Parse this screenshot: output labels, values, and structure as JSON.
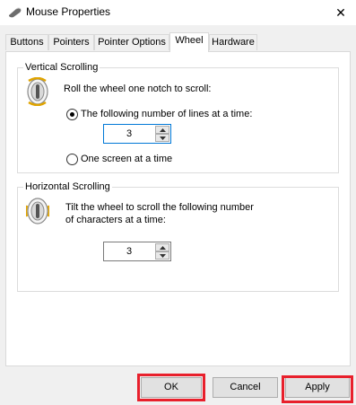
{
  "window": {
    "title": "Mouse Properties",
    "close_glyph": "✕",
    "icon": "mouse-icon"
  },
  "tabs": [
    {
      "label": "Buttons"
    },
    {
      "label": "Pointers"
    },
    {
      "label": "Pointer Options"
    },
    {
      "label": "Wheel",
      "active": true
    },
    {
      "label": "Hardware"
    }
  ],
  "vertical": {
    "label": "Vertical Scrolling",
    "description": "Roll the wheel one notch to scroll:",
    "option_lines": "The following number of lines at a time:",
    "lines_value": "3",
    "option_screen": "One screen at a time",
    "selected": "lines"
  },
  "horizontal": {
    "label": "Horizontal Scrolling",
    "description_line1": "Tilt the wheel to scroll the following number",
    "description_line2": "of characters at a time:",
    "chars_value": "3"
  },
  "buttons": {
    "ok": "OK",
    "cancel": "Cancel",
    "apply": "Apply"
  },
  "colors": {
    "highlight": "#e8202c",
    "focus": "#0078d7"
  }
}
